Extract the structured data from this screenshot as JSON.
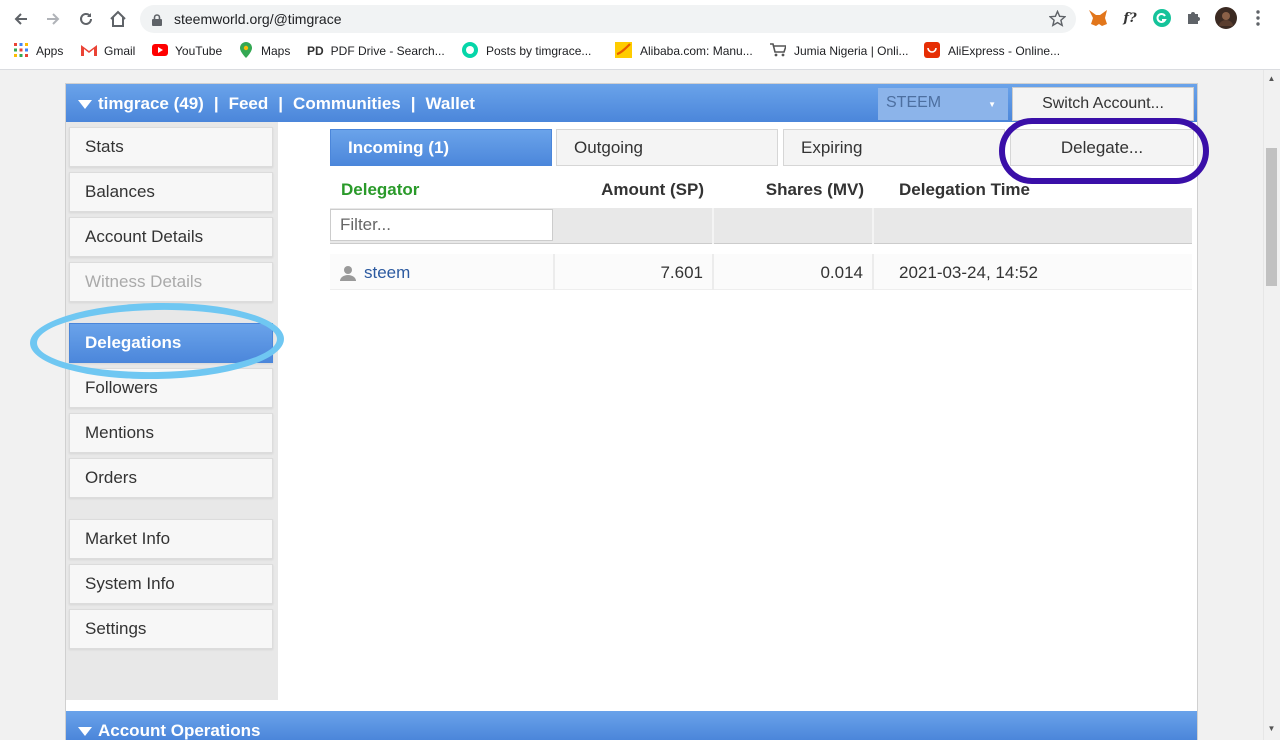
{
  "browser": {
    "url": "steemworld.org/@timgrace",
    "bookmarks": [
      {
        "label": "Apps",
        "icon": "apps-grid-icon",
        "color": "#ea4335"
      },
      {
        "label": "Gmail",
        "icon": "gmail-icon",
        "color": "#ea4335"
      },
      {
        "label": "YouTube",
        "icon": "youtube-icon",
        "color": "#ff0000"
      },
      {
        "label": "Maps",
        "icon": "maps-pin-icon",
        "color": "#34a853"
      },
      {
        "label": "PDF Drive - Search...",
        "icon": "pdfdrive-icon",
        "color": "#333333"
      },
      {
        "label": "Posts by timgrace...",
        "icon": "steemit-icon",
        "color": "#06d6a9"
      },
      {
        "label": "Alibaba.com: Manu...",
        "icon": "alibaba-icon",
        "color": "#ff9900"
      },
      {
        "label": "Jumia Nigeria | Onli...",
        "icon": "jumia-cart-icon",
        "color": "#f68b1e"
      },
      {
        "label": "AliExpress - Online...",
        "icon": "aliexpress-icon",
        "color": "#e62e04"
      }
    ],
    "extensions": {
      "formula": "f?"
    }
  },
  "topbar": {
    "username": "timgrace (49)",
    "links": [
      "Feed",
      "Communities",
      "Wallet"
    ],
    "separator": "|",
    "coin": "STEEM",
    "switch_account": "Switch Account..."
  },
  "sidebar": {
    "items": [
      {
        "label": "Stats"
      },
      {
        "label": "Balances"
      },
      {
        "label": "Account Details"
      },
      {
        "label": "Witness Details"
      },
      {
        "label": "Delegations"
      },
      {
        "label": "Followers"
      },
      {
        "label": "Mentions"
      },
      {
        "label": "Orders"
      },
      {
        "label": "Market Info"
      },
      {
        "label": "System Info"
      },
      {
        "label": "Settings"
      }
    ]
  },
  "tabs": [
    {
      "label": "Incoming (1)"
    },
    {
      "label": "Outgoing"
    },
    {
      "label": "Expiring"
    }
  ],
  "delegate_button": "Delegate...",
  "table": {
    "headers": [
      "Delegator",
      "Amount (SP)",
      "Shares (MV)",
      "Delegation Time"
    ],
    "filter_placeholder": "Filter...",
    "rows": [
      {
        "delegator": "steem",
        "amount": "7.601",
        "shares": "0.014",
        "time": "2021-03-24, 14:52"
      }
    ]
  },
  "bottom_section": {
    "title": "Account Operations"
  },
  "colors": {
    "accent_blue": "#4b86da",
    "header_green": "#2a9a2a",
    "link_blue": "#2c5aa0",
    "annotation_cyan": "#6fc7f2",
    "annotation_purple": "#3a0fa8"
  }
}
